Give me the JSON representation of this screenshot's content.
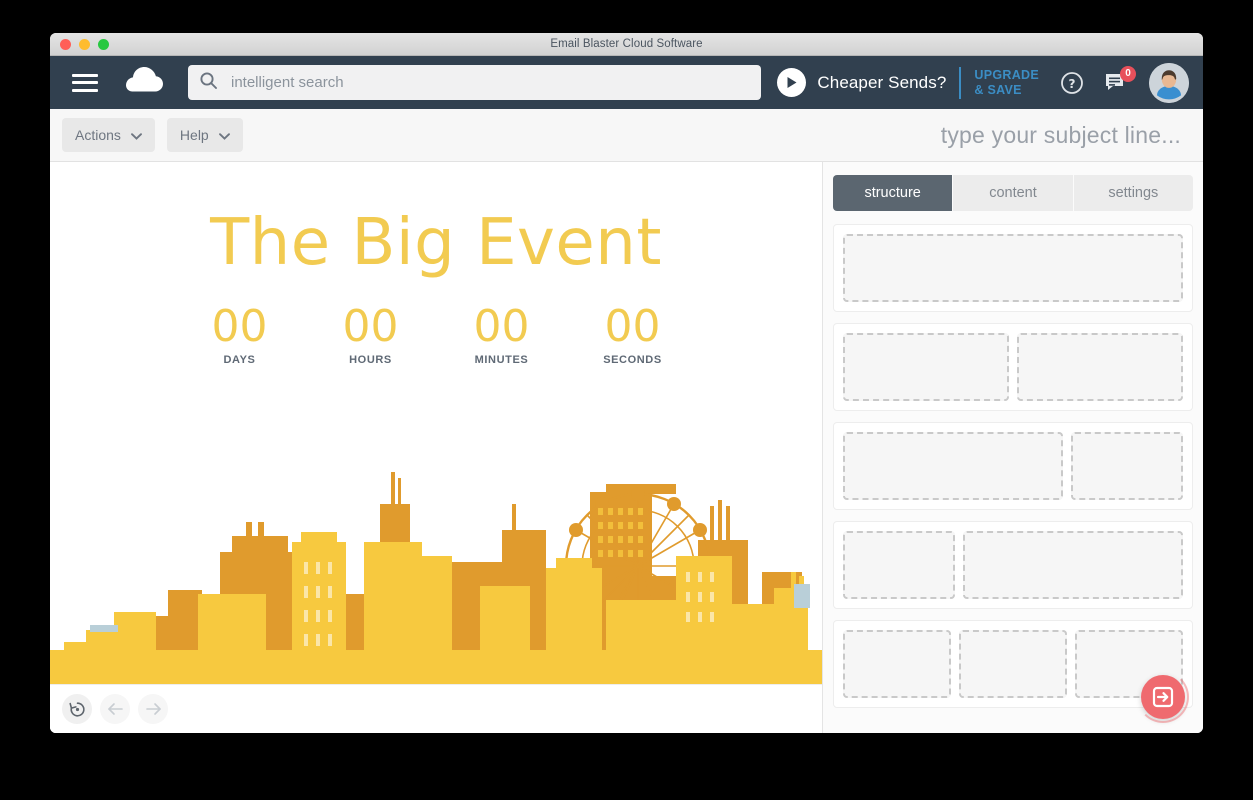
{
  "window": {
    "title": "Email Blaster Cloud Software",
    "controls": [
      "close",
      "minimize",
      "maximize"
    ]
  },
  "header": {
    "menu_icon": "hamburger-menu-icon",
    "logo_icon": "cloud-icon",
    "search": {
      "icon": "search-icon",
      "value": "intelligent search",
      "placeholder": "intelligent search"
    },
    "promo": {
      "play_icon": "play-icon",
      "text": "Cheaper Sends?",
      "upgrade_line1": "UPGRADE",
      "upgrade_line2": "& SAVE",
      "accent_color": "#3b8dc4"
    },
    "help_icon": "question-mark-icon",
    "messages": {
      "icon": "message-icon",
      "badge_count": "0",
      "badge_color": "#e8505b"
    },
    "avatar": "user-avatar",
    "background_color": "#31404f"
  },
  "toolbar": {
    "actions_label": "Actions",
    "help_label": "Help",
    "caret_icon": "chevron-down-icon",
    "subject_placeholder": "type your subject line..."
  },
  "canvas": {
    "headline": "The Big Event",
    "headline_color": "#f2cb51",
    "countdown": [
      {
        "value": "00",
        "label": "DAYS"
      },
      {
        "value": "00",
        "label": "HOURS"
      },
      {
        "value": "00",
        "label": "MINUTES"
      },
      {
        "value": "00",
        "label": "SECONDS"
      }
    ],
    "illustration": "city-skyline-with-ferris-wheel",
    "skyline_colors": {
      "light": "#f7c93f",
      "mid": "#f0b937",
      "dark": "#e09b2d",
      "accent": "#b9cfd8"
    },
    "footer_buttons": [
      {
        "name": "restore-history-button",
        "icon": "restore-icon",
        "enabled": true
      },
      {
        "name": "undo-button",
        "icon": "arrow-left-icon",
        "enabled": false
      },
      {
        "name": "redo-button",
        "icon": "arrow-right-icon",
        "enabled": false
      }
    ]
  },
  "right_panel": {
    "tabs": [
      {
        "label": "structure",
        "active": true
      },
      {
        "label": "content",
        "active": false
      },
      {
        "label": "settings",
        "active": false
      }
    ],
    "active_tab_color": "#5b6670",
    "structure_blocks": [
      {
        "name": "one-column-block",
        "columns": [
          1
        ]
      },
      {
        "name": "two-column-equal-block",
        "columns": [
          1,
          1
        ]
      },
      {
        "name": "two-column-wide-narrow-block",
        "columns": [
          2,
          1
        ]
      },
      {
        "name": "two-column-narrow-wide-block",
        "columns": [
          1,
          2
        ]
      },
      {
        "name": "three-column-block",
        "columns": [
          1,
          1,
          1
        ]
      }
    ],
    "fab": {
      "name": "export-button",
      "icon": "arrow-into-box-icon",
      "color": "#ef6a6f"
    }
  }
}
